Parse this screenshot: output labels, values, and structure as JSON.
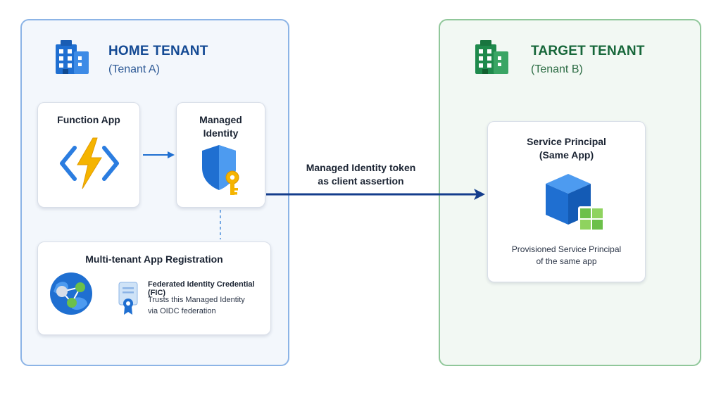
{
  "home_tenant": {
    "title": "HOME TENANT",
    "subtitle": "(Tenant A)"
  },
  "target_tenant": {
    "title": "TARGET TENANT",
    "subtitle": "(Tenant B)"
  },
  "function_app": {
    "label": "Function App",
    "icon": "azure-function-icon"
  },
  "managed_identity": {
    "label_line1": "Managed",
    "label_line2": "Identity",
    "icon": "shield-key-icon"
  },
  "app_registration": {
    "title": "Multi-tenant App Registration",
    "fic_title": "Federated Identity Credential (FIC)",
    "fic_line1": "Trusts this Managed Identity",
    "fic_line2": "via OIDC federation"
  },
  "flow": {
    "line1": "Managed Identity token",
    "line2": "as client assertion"
  },
  "service_principal": {
    "title_line1": "Service Principal",
    "title_line2": "(Same App)",
    "desc_line1": "Provisioned Service Principal",
    "desc_line2": "of the same app"
  },
  "colors": {
    "home_accent": "#1f6fd1",
    "target_accent": "#1f8a4c",
    "arrow": "#143d8c"
  }
}
